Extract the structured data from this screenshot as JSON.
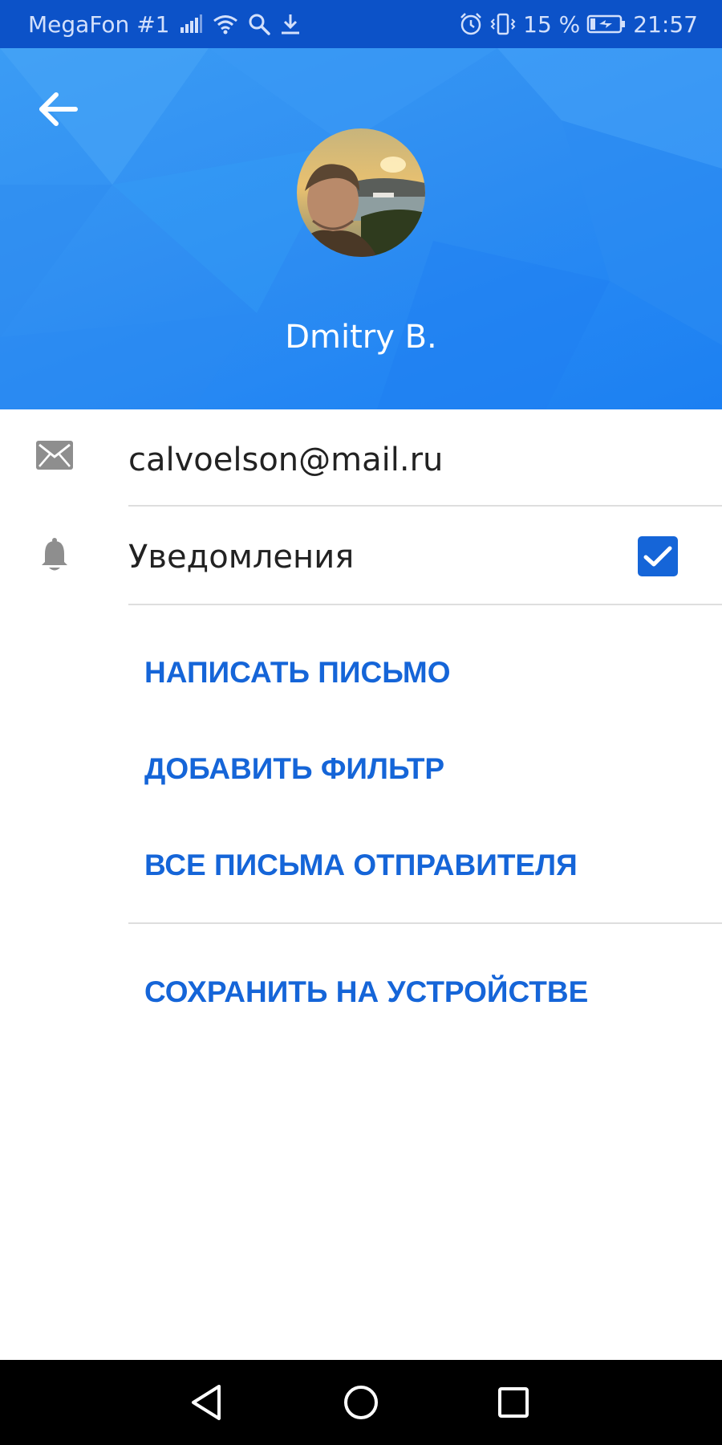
{
  "status_bar": {
    "carrier": "MegaFon #1",
    "battery": "15 %",
    "time": "21:57",
    "icons": [
      "signal-icon",
      "wifi-icon",
      "search-icon",
      "download-icon",
      "alarm-icon",
      "vibrate-icon",
      "battery-charging-icon"
    ]
  },
  "profile": {
    "name": "Dmitry B."
  },
  "email_row": {
    "icon": "mail-icon",
    "email": "calvoelson@mail.ru"
  },
  "notifications_row": {
    "icon": "bell-icon",
    "label": "Уведомления",
    "checked": true
  },
  "actions": {
    "write_letter": "НАПИСАТЬ ПИСЬМО",
    "add_filter": "ДОБАВИТЬ ФИЛЬТР",
    "all_sender_letters": "ВСЕ ПИСЬМА ОТПРАВИТЕЛЯ",
    "save_on_device": "СОХРАНИТЬ НА УСТРОЙСТВЕ"
  },
  "colors": {
    "status_bar": "#0c52c8",
    "header": "#2f8ef2",
    "accent": "#1565d8",
    "divider": "#dedede",
    "nav_bar": "#000000"
  }
}
